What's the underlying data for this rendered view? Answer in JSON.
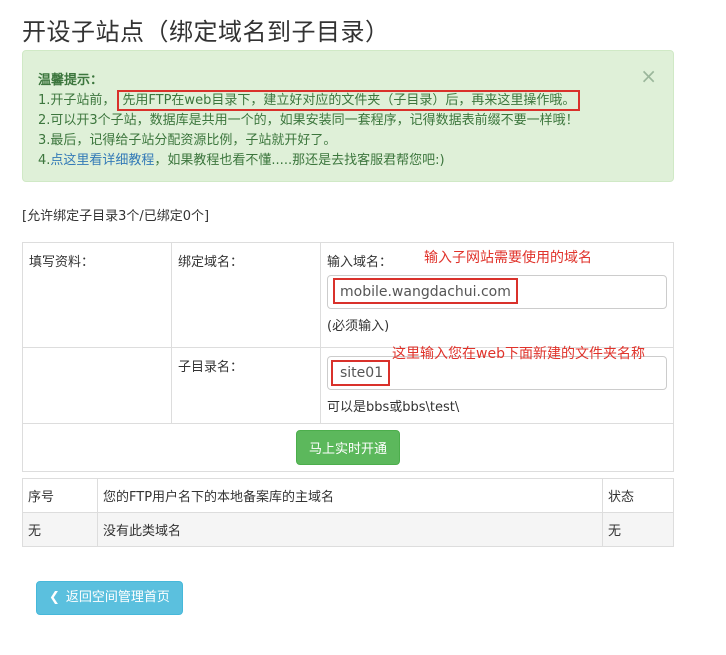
{
  "page": {
    "title": "开设子站点（绑定域名到子目录）"
  },
  "alert": {
    "title": "温馨提示：",
    "close": "×",
    "line1_prefix": "1.开子站前，",
    "line1_boxed": "先用FTP在web目录下，建立好对应的文件夹（子目录）后，再来这里操作哦。",
    "line2": "2.可以开3个子站，数据库是共用一个的，如果安装同一套程序，记得数据表前缀不要一样哦！",
    "line3": "3.最后，记得给子站分配资源比例，子站就开好了。",
    "line4_prefix": "4.",
    "line4_link": "点这里看详细教程",
    "line4_suffix": "，如果教程也看不懂.....那还是去找客服君帮您吧:)"
  },
  "quota": "[允许绑定子目录3个/已绑定0个]",
  "form": {
    "fill_label": "填写资料：",
    "bind_label": "绑定域名：",
    "domain_label": "输入域名：",
    "domain_value": "mobile.wangdachui.com",
    "domain_hint": "(必须输入)",
    "domain_annotation": "输入子网站需要使用的域名",
    "subdir_label": "子目录名：",
    "subdir_value": "site01",
    "subdir_hint": "可以是bbs或bbs\\test\\",
    "subdir_annotation": "这里输入您在web下面新建的文件夹名称",
    "submit": "马上实时开通"
  },
  "list": {
    "headers": [
      "序号",
      "您的FTP用户名下的本地备案库的主域名",
      "状态"
    ],
    "rows": [
      [
        "无",
        "没有此类域名",
        "无"
      ]
    ]
  },
  "back_button": "返回空间管理首页",
  "colors": {
    "alert_bg": "#dff0d8",
    "alert_text": "#3c763d",
    "annotation_red": "#e0332b",
    "submit_green": "#5cb85c",
    "back_blue": "#5bc0de"
  }
}
